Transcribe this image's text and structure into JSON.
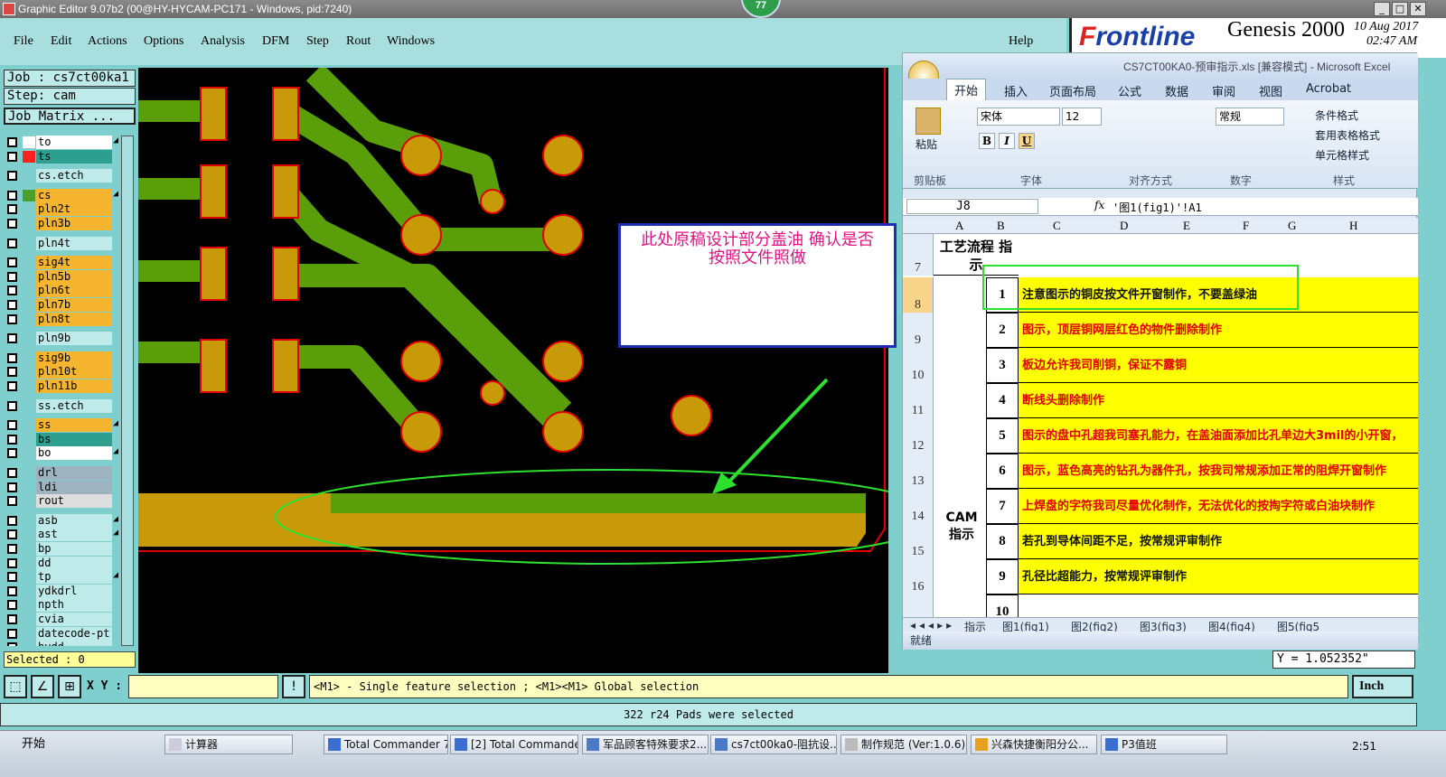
{
  "window": {
    "title": "Graphic Editor 9.07b2 (00@HY-HYCAM-PC171 - Windows, pid:7240)",
    "badge": "77",
    "min": "_",
    "max": "□",
    "close": "✕"
  },
  "menu": [
    "File",
    "Edit",
    "Actions",
    "Options",
    "Analysis",
    "DFM",
    "Step",
    "Rout",
    "Windows"
  ],
  "help": "Help",
  "brand": {
    "logo_prefix": "F",
    "logo_rest": "rontline",
    "product": "Genesis 2000",
    "date": "10 Aug 2017",
    "time": "02:47 AM"
  },
  "job": {
    "job": "Job : cs7ct00ka1",
    "step": "Step: cam",
    "matrix_button": "Job Matrix ..."
  },
  "layers": [
    {
      "name": "to",
      "color": "#ffffff",
      "sw": "#ffffff",
      "arrow": true
    },
    {
      "name": "ts",
      "color": "#2e9e8e",
      "sw": "#ff2020",
      "arrow": false
    },
    {
      "name": "cs.etch",
      "color": "#bfeaea",
      "sw": "#7fcfcf",
      "arrow": false
    },
    {
      "name": "cs",
      "color": "#f5b52e",
      "sw": "#4aa02a",
      "arrow": true
    },
    {
      "name": "pln2t",
      "color": "#f5b52e",
      "sw": "#7fcfcf",
      "arrow": false
    },
    {
      "name": "pln3b",
      "color": "#f5b52e",
      "sw": "#7fcfcf",
      "arrow": false
    },
    {
      "name": "pln4t",
      "color": "#bfeaea",
      "sw": "#7fcfcf",
      "arrow": false
    },
    {
      "name": "sig4t",
      "color": "#f5b52e",
      "sw": "#7fcfcf",
      "arrow": false
    },
    {
      "name": "pln5b",
      "color": "#f5b52e",
      "sw": "#7fcfcf",
      "arrow": false
    },
    {
      "name": "pln6t",
      "color": "#f5b52e",
      "sw": "#7fcfcf",
      "arrow": false
    },
    {
      "name": "pln7b",
      "color": "#f5b52e",
      "sw": "#7fcfcf",
      "arrow": false
    },
    {
      "name": "pln8t",
      "color": "#f5b52e",
      "sw": "#7fcfcf",
      "arrow": false
    },
    {
      "name": "pln9b",
      "color": "#bfeaea",
      "sw": "#7fcfcf",
      "arrow": false
    },
    {
      "name": "sig9b",
      "color": "#f5b52e",
      "sw": "#7fcfcf",
      "arrow": false
    },
    {
      "name": "pln10t",
      "color": "#f5b52e",
      "sw": "#7fcfcf",
      "arrow": false
    },
    {
      "name": "pln11b",
      "color": "#f5b52e",
      "sw": "#7fcfcf",
      "arrow": false
    },
    {
      "name": "ss.etch",
      "color": "#bfeaea",
      "sw": "#7fcfcf",
      "arrow": false
    },
    {
      "name": "ss",
      "color": "#f5b52e",
      "sw": "#7fcfcf",
      "arrow": true
    },
    {
      "name": "bs",
      "color": "#2e9e8e",
      "sw": "#7fcfcf",
      "arrow": false
    },
    {
      "name": "bo",
      "color": "#ffffff",
      "sw": "#7fcfcf",
      "arrow": true
    },
    {
      "name": "drl",
      "color": "#9fb2bf",
      "sw": "#7fcfcf",
      "arrow": false
    },
    {
      "name": "ldi",
      "color": "#9fb2bf",
      "sw": "#7fcfcf",
      "arrow": false
    },
    {
      "name": "rout",
      "color": "#dddddd",
      "sw": "#7fcfcf",
      "arrow": false
    },
    {
      "name": "asb",
      "color": "#bfeaea",
      "sw": "#7fcfcf",
      "arrow": true
    },
    {
      "name": "ast",
      "color": "#bfeaea",
      "sw": "#7fcfcf",
      "arrow": true
    },
    {
      "name": "bp",
      "color": "#bfeaea",
      "sw": "#7fcfcf",
      "arrow": false
    },
    {
      "name": "dd",
      "color": "#bfeaea",
      "sw": "#7fcfcf",
      "arrow": false
    },
    {
      "name": "tp",
      "color": "#bfeaea",
      "sw": "#7fcfcf",
      "arrow": true
    },
    {
      "name": "ydkdrl",
      "color": "#bfeaea",
      "sw": "#7fcfcf",
      "arrow": false
    },
    {
      "name": "npth",
      "color": "#bfeaea",
      "sw": "#7fcfcf",
      "arrow": false
    },
    {
      "name": "cvia",
      "color": "#bfeaea",
      "sw": "#7fcfcf",
      "arrow": false
    },
    {
      "name": "datecode-pt",
      "color": "#bfeaea",
      "sw": "#7fcfcf",
      "arrow": false
    },
    {
      "name": "hvdd",
      "color": "#bfeaea",
      "sw": "#7fcfcf",
      "arrow": false
    }
  ],
  "selected": "Selected : 0",
  "annotation": {
    "line1": "此处原稿设计部分盖油 确认是否",
    "line2": "按照文件照做"
  },
  "excel": {
    "title": "CS7CT00KA0-预审指示.xls [兼容模式] - Microsoft Excel",
    "tabs": [
      "开始",
      "插入",
      "页面布局",
      "公式",
      "数据",
      "审阅",
      "视图",
      "Acrobat"
    ],
    "font_name": "宋体",
    "font_size": "12",
    "number_format": "常规",
    "groups": [
      "剪贴板",
      "字体",
      "对齐方式",
      "数字",
      "样式"
    ],
    "paste": "粘贴",
    "styles": [
      "条件格式",
      "套用表格格式",
      "单元格样式"
    ],
    "name_box": "J8",
    "fx": "fx",
    "formula": "'图1(fig1)'!A1",
    "columns": [
      "A",
      "B",
      "C",
      "D",
      "E",
      "F",
      "G",
      "H"
    ],
    "header_a7": "工艺流程 指示",
    "cam_label": "CAM 指示",
    "rows": [
      {
        "r": "7",
        "n": "",
        "text": "",
        "dark": false
      },
      {
        "r": "8",
        "n": "1",
        "text": "注意图示的铜皮按文件开窗制作，不要盖绿油",
        "dark": true
      },
      {
        "r": "9",
        "n": "2",
        "text": "图示，顶层铜网层红色的物件删除制作",
        "dark": false
      },
      {
        "r": "10",
        "n": "3",
        "text": "板边允许我司削铜，保证不露铜",
        "dark": false
      },
      {
        "r": "11",
        "n": "4",
        "text": "断线头删除制作",
        "dark": false
      },
      {
        "r": "12",
        "n": "5",
        "text": "图示的盘中孔超我司塞孔能力，在盖油面添加比孔单边大3mil的小开窗，",
        "dark": false
      },
      {
        "r": "13",
        "n": "6",
        "text": "图示，蓝色高亮的钻孔为器件孔，按我司常规添加正常的阻焊开窗制作",
        "dark": false
      },
      {
        "r": "14",
        "n": "7",
        "text": "上焊盘的字符我司尽量优化制作，无法优化的按掏字符或白油块制作",
        "dark": false
      },
      {
        "r": "15",
        "n": "8",
        "text": "若孔到导体间距不足，按常规评审制作",
        "dark": true
      },
      {
        "r": "16",
        "n": "9",
        "text": "孔径比超能力，按常规评审制作",
        "dark": true
      },
      {
        "r": "",
        "n": "10",
        "text": "",
        "dark": false
      }
    ],
    "sheets": [
      "指示",
      "图1(fig1)",
      "图2(fig2)",
      "图3(fig3)",
      "图4(fig4)",
      "图5(fig5"
    ],
    "status": "就绪"
  },
  "y_readout": "Y = 1.052352\"",
  "xy_label": "X Y :",
  "hint": "<M1> - Single feature selection ; <M1><M1> Global selection",
  "unit": "Inch",
  "status_line": "322 r24 Pads were selected",
  "taskbar": {
    "start": "开始",
    "items": [
      "计算器",
      "Total Commander 7.0...",
      "[2] Total Commander ...",
      "军品顾客特殊要求2...",
      "cs7ct00ka0-阻抗设...",
      "制作规范 (Ver:1.0.6)",
      "兴森快捷衡阳分公...",
      "P3值班"
    ],
    "clock": "2:51"
  }
}
